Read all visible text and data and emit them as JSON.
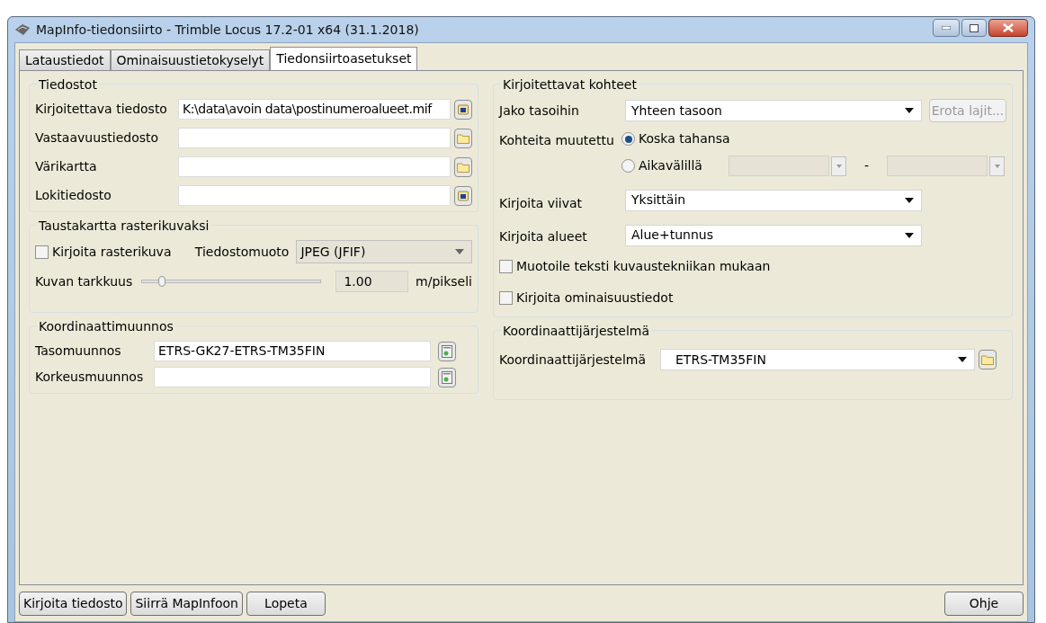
{
  "window": {
    "title": "MapInfo-tiedonsiirto - Trimble Locus 17.2-01 x64 (31.1.2018)"
  },
  "tabs": [
    {
      "label": "Lataustiedot",
      "selected": false
    },
    {
      "label": "Ominaisuustietokyselyt",
      "selected": false
    },
    {
      "label": "Tiedonsiirtoasetukset",
      "selected": true
    }
  ],
  "files": {
    "title": "Tiedostot",
    "rows": [
      {
        "label": "Kirjoitettava tiedosto",
        "value": "K:\\data\\avoin data\\postinumeroalueet.mif",
        "kind": "save"
      },
      {
        "label": "Vastaavuustiedosto",
        "kind": "folder"
      },
      {
        "label": "Värikartta",
        "kind": "folder"
      },
      {
        "label": "Lokitiedosto",
        "kind": "save"
      }
    ]
  },
  "raster": {
    "title": "Taustakartta rasterikuvaksi",
    "checkbox": {
      "label": "Kirjoita rasterikuva",
      "checked": false
    },
    "format_label": "Tiedostomuoto",
    "format": "JPEG (JFIF)",
    "resolution_label": "Kuvan tarkkuus",
    "slider": {
      "level": 0.11
    },
    "resolution": "1.00",
    "unit": "m/pikseli"
  },
  "transform": {
    "title": "Koordinaattimuunnos",
    "rows": [
      {
        "label": "Tasomuunnos",
        "value": "ETRS-GK27-ETRS-TM35FIN"
      },
      {
        "label": "Korkeusmuunnos"
      }
    ]
  },
  "targets": {
    "title": "Kirjoitettavat kohteet",
    "split_label": "Jako tasoihin",
    "split": "Yhteen tasoon",
    "split_button": {
      "label": "Erota lajit...",
      "disabled": true
    },
    "modified_label": "Kohteita muutettu",
    "radios": [
      {
        "label": "Koska tahansa",
        "selected": true
      },
      {
        "label": "Aikavälillä",
        "selected": false
      }
    ],
    "range_separator": "-",
    "lines_label": "Kirjoita viivat",
    "lines": "Yksittäin",
    "areas_label": "Kirjoita alueet",
    "areas": "Alue+tunnus",
    "checkboxes": [
      {
        "label": "Muotoile teksti kuvaustekniikan mukaan",
        "checked": false
      },
      {
        "label": "Kirjoita ominaisuustiedot",
        "checked": false
      }
    ]
  },
  "crs": {
    "title": "Koordinaattijärjestelmä",
    "label": "Koordinaattijärjestelmä",
    "value": "ETRS-TM35FIN"
  },
  "buttons": [
    "Kirjoita tiedosto",
    "Siirrä MapInfoon",
    "Lopeta"
  ],
  "help_button": "Ohje"
}
